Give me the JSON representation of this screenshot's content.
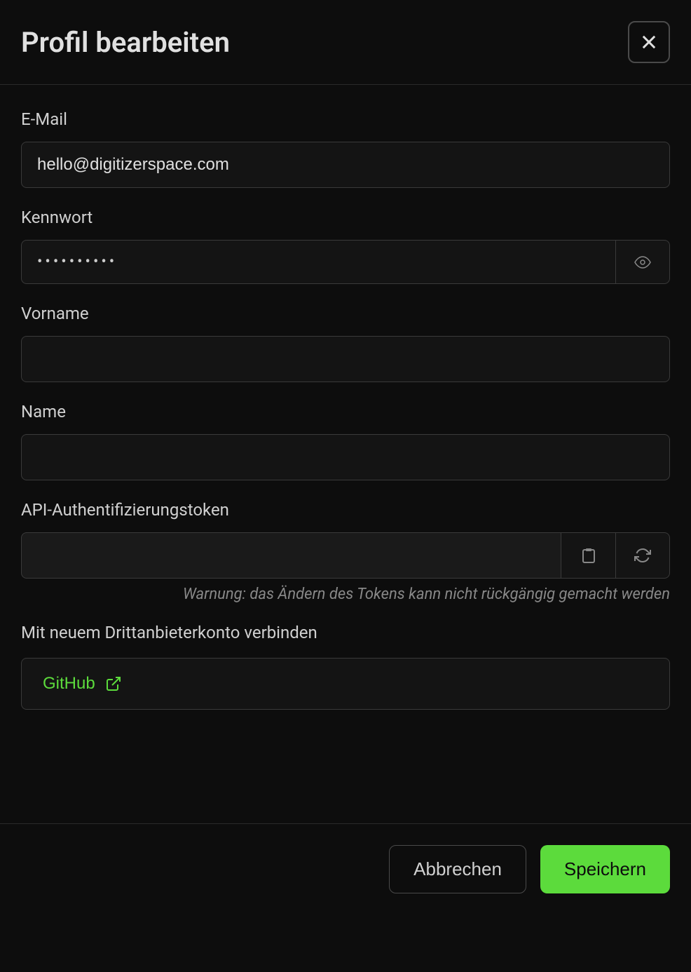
{
  "header": {
    "title": "Profil bearbeiten"
  },
  "form": {
    "email": {
      "label": "E-Mail",
      "value": "hello@digitizerspace.com"
    },
    "password": {
      "label": "Kennwort",
      "value": "••••••••••"
    },
    "firstname": {
      "label": "Vorname",
      "value": ""
    },
    "lastname": {
      "label": "Name",
      "value": ""
    },
    "api_token": {
      "label": "API-Authentifizierungstoken",
      "value": "",
      "warning": "Warnung: das Ändern des Tokens kann nicht rückgängig gemacht werden"
    },
    "third_party": {
      "label": "Mit neuem Drittanbieterkonto verbinden",
      "github_label": "GitHub"
    }
  },
  "footer": {
    "cancel_label": "Abbrechen",
    "save_label": "Speichern"
  }
}
